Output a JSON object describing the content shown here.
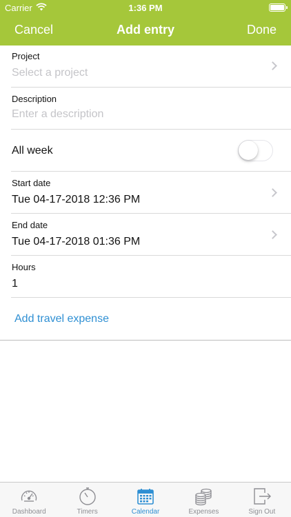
{
  "status_bar": {
    "carrier": "Carrier",
    "time": "1:36 PM"
  },
  "nav": {
    "cancel": "Cancel",
    "title": "Add entry",
    "done": "Done"
  },
  "form": {
    "project": {
      "label": "Project",
      "placeholder": "Select a project"
    },
    "description": {
      "label": "Description",
      "placeholder": "Enter a description"
    },
    "all_week": {
      "label": "All week",
      "on": false
    },
    "start_date": {
      "label": "Start date",
      "value": "Tue 04-17-2018 12:36 PM"
    },
    "end_date": {
      "label": "End date",
      "value": "Tue 04-17-2018 01:36 PM"
    },
    "hours": {
      "label": "Hours",
      "value": "1"
    },
    "travel_expense_link": "Add travel expense"
  },
  "tabs": [
    {
      "label": "Dashboard",
      "icon": "speedometer-icon",
      "active": false
    },
    {
      "label": "Timers",
      "icon": "stopwatch-icon",
      "active": false
    },
    {
      "label": "Calendar",
      "icon": "calendar-icon",
      "active": true
    },
    {
      "label": "Expenses",
      "icon": "coins-icon",
      "active": false
    },
    {
      "label": "Sign Out",
      "icon": "sign-out-icon",
      "active": false
    }
  ],
  "colors": {
    "brand": "#a5c73a",
    "accent": "#2e8fd3",
    "inactive": "#8e8e93"
  }
}
